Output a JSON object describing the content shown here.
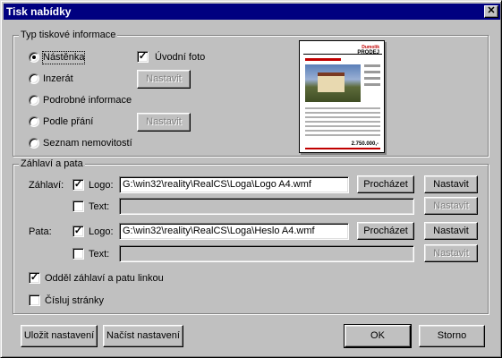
{
  "window": {
    "title": "Tisk nabídky",
    "close_glyph": "✕"
  },
  "print_type": {
    "legend": "Typ tiskové informace",
    "options": [
      {
        "label": "Nástěnka",
        "checked": true
      },
      {
        "label": "Inzerát",
        "checked": false
      },
      {
        "label": "Podrobné informace",
        "checked": false
      },
      {
        "label": "Podle přání",
        "checked": false
      },
      {
        "label": "Seznam nemovitostí",
        "checked": false
      }
    ],
    "intro_photo_label": "Úvodní foto",
    "intro_photo_checked": true,
    "setup_label_1": "Nastavit",
    "setup_label_2": "Nastavit",
    "preview": {
      "brand": "Dumolik",
      "heading": "PRODEJ",
      "price": "2.750.000,-"
    }
  },
  "header_footer": {
    "legend": "Záhlaví a pata",
    "header_label": "Záhlaví:",
    "footer_label": "Pata:",
    "logo_label": "Logo:",
    "text_label": "Text:",
    "header_logo_checked": true,
    "header_logo_path": "G:\\win32\\reality\\RealCS\\Loga\\Logo A4.wmf",
    "header_text_checked": false,
    "header_text_value": "",
    "footer_logo_checked": true,
    "footer_logo_path": "G:\\win32\\reality\\RealCS\\Loga\\Heslo A4.wmf",
    "footer_text_checked": false,
    "footer_text_value": "",
    "browse_label": "Procházet",
    "setup_label": "Nastavit",
    "separate_line_label": "Odděl záhlaví a patu linkou",
    "separate_line_checked": true,
    "number_pages_label": "Čísluj stránky",
    "number_pages_checked": false
  },
  "footer_buttons": {
    "save_settings": "Uložit nastavení",
    "load_settings": "Načíst nastavení",
    "ok": "OK",
    "cancel": "Storno"
  }
}
